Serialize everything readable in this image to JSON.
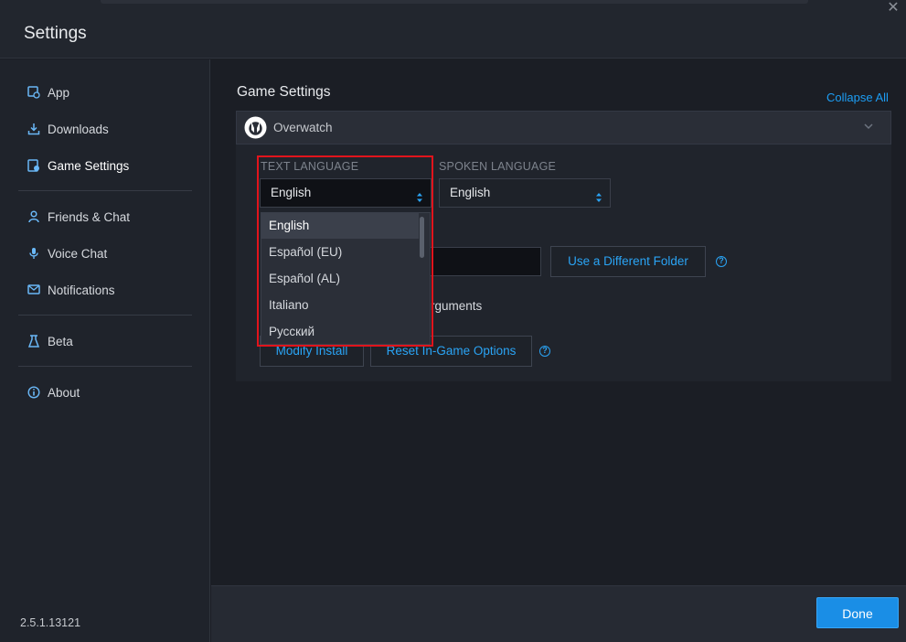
{
  "window": {
    "title": "Settings",
    "close_glyph": "✕"
  },
  "sidebar": {
    "items": [
      {
        "label": "App",
        "icon": "app-icon"
      },
      {
        "label": "Downloads",
        "icon": "download-icon"
      },
      {
        "label": "Game Settings",
        "icon": "game-settings-icon",
        "active": true
      },
      {
        "label": "Friends & Chat",
        "icon": "friends-icon"
      },
      {
        "label": "Voice Chat",
        "icon": "microphone-icon"
      },
      {
        "label": "Notifications",
        "icon": "notifications-icon"
      },
      {
        "label": "Beta",
        "icon": "beta-flask-icon"
      },
      {
        "label": "About",
        "icon": "info-icon"
      }
    ],
    "version": "2.5.1.13121"
  },
  "main": {
    "title": "Game Settings",
    "collapse_all": "Collapse All",
    "game": {
      "name": "Overwatch",
      "text_language_label": "TEXT LANGUAGE",
      "text_language_value": "English",
      "spoken_language_label": "SPOKEN LANGUAGE",
      "spoken_language_value": "English",
      "use_different_folder": "Use a Different Folder",
      "arguments_partial": "rguments",
      "modify_install": "Modify Install",
      "reset_options": "Reset In-Game Options",
      "help_glyph": "?"
    },
    "dropdown": {
      "options": [
        "English",
        "Español (EU)",
        "Español (AL)",
        "Italiano",
        "Русский"
      ],
      "selected_index": 0
    }
  },
  "footer": {
    "done_label": "Done"
  },
  "colors": {
    "accent": "#1a8ee6",
    "link": "#2aa4f5",
    "highlight_box": "#e1141c",
    "background": "#1b1e25"
  }
}
